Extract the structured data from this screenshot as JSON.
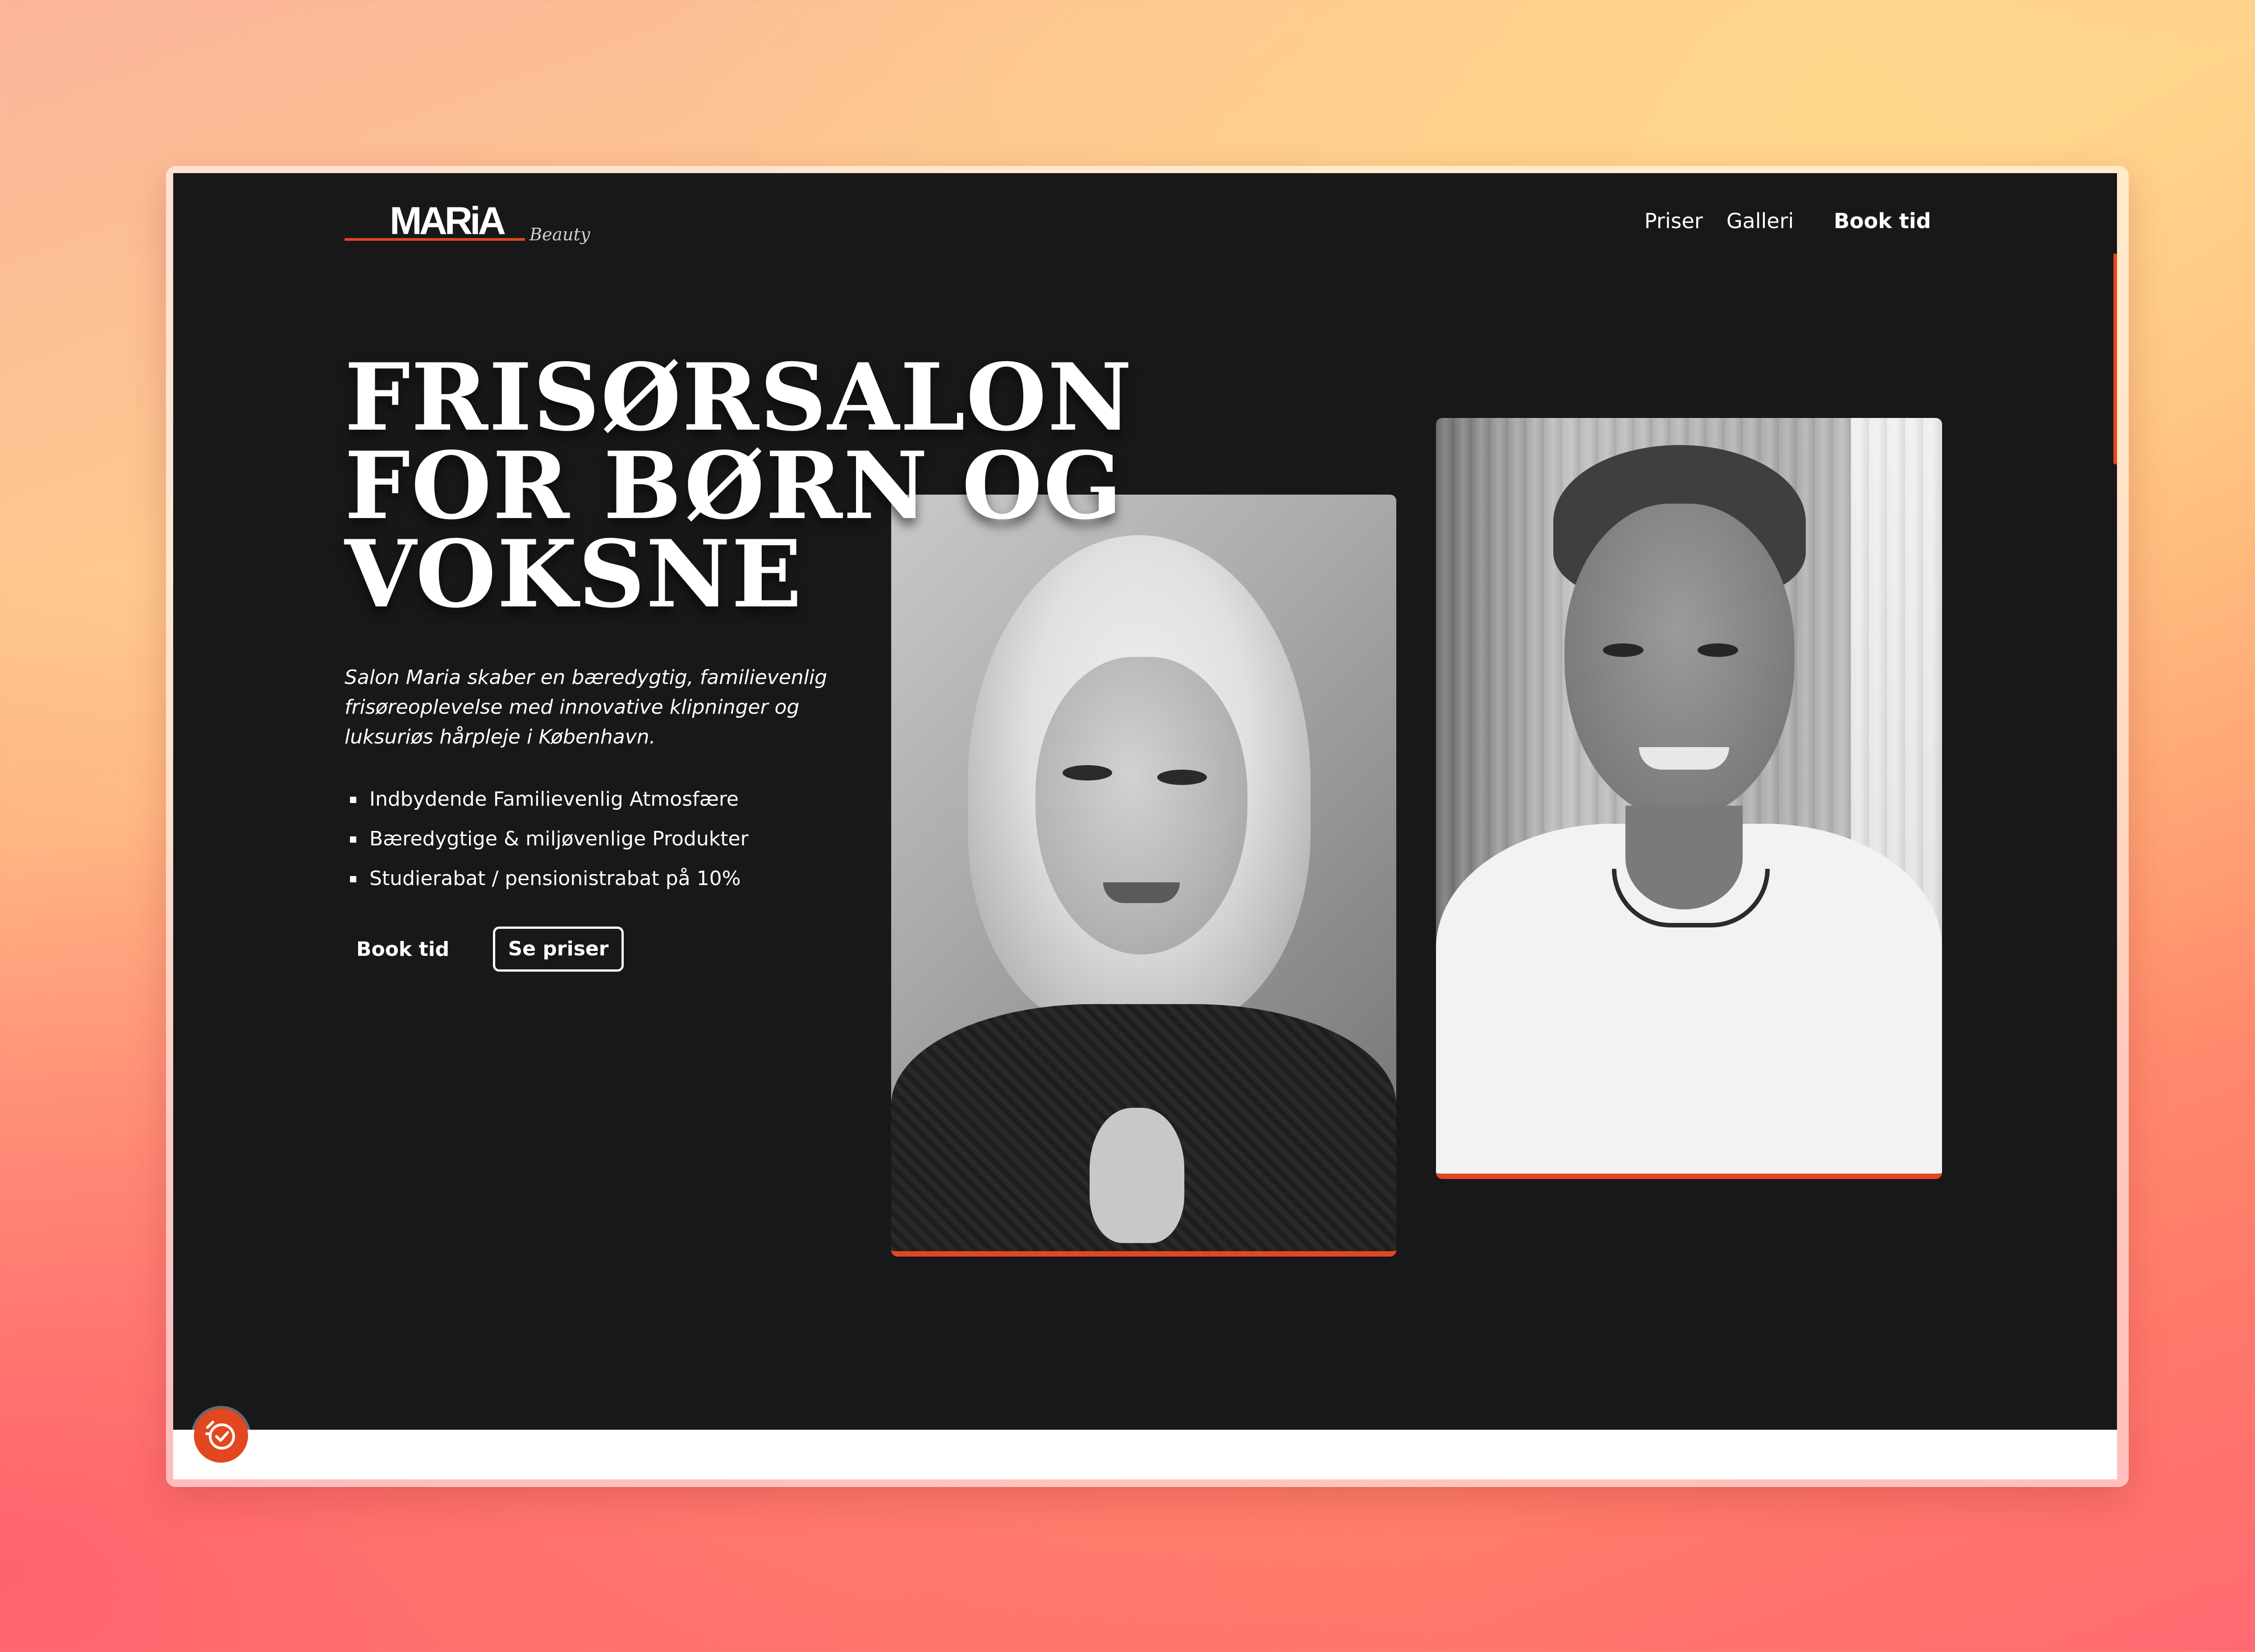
{
  "header": {
    "logo_main": "MARiA",
    "logo_sub": "Beauty",
    "nav": [
      "Priser",
      "Galleri"
    ],
    "book_label": "Book tid"
  },
  "hero": {
    "headline": [
      "FRISØRSALON",
      "FOR BØRN OG",
      "VOKSNE"
    ],
    "intro": "Salon Maria skaber en bæredygtig, familievenlig frisøreoplevelse med innovative klipninger og luksuriøs hårpleje i København.",
    "bullets": [
      "Indbydende Familievenlig Atmosfære",
      "Bæredygtige & miljøvenlige Produkter",
      "Studierabat / pensionistrabat på 10%"
    ],
    "primary_button": "Book tid",
    "secondary_button": "Se priser"
  },
  "icons": {
    "badge": "clock-check-icon"
  },
  "colors": {
    "background": "#18181a",
    "accent": "#e2471f",
    "text": "#ffffff"
  }
}
